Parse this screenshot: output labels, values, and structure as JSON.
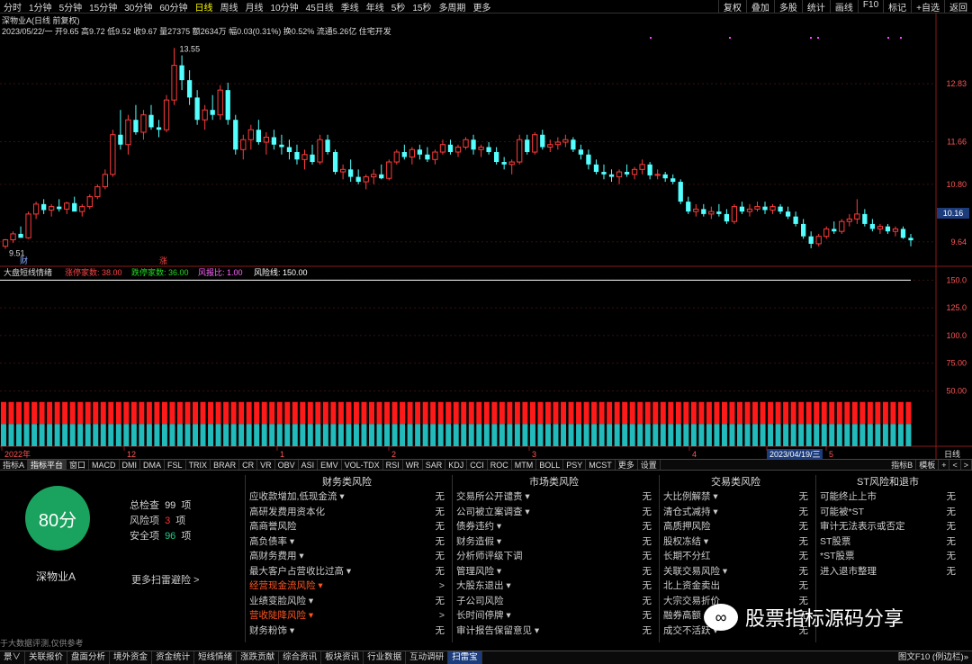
{
  "topbar": {
    "tabs": [
      "分时",
      "1分钟",
      "5分钟",
      "15分钟",
      "30分钟",
      "60分钟",
      "日线",
      "周线",
      "月线",
      "10分钟",
      "45日线",
      "季线",
      "年线",
      "5秒",
      "15秒",
      "多周期",
      "更多"
    ],
    "active_tab": "日线",
    "right_buttons": [
      "复权",
      "叠加",
      "多股",
      "统计",
      "画线",
      "F10",
      "标记",
      "+自选",
      "返回"
    ]
  },
  "info": {
    "title": "深物业A(日线 前复权)",
    "line": "2023/05/22/一  开9.65 高9.72 低9.52 收9.67 量27375 额2634万 幅0.03(0.31%) 换0.52% 流通5.26亿 住宅开发",
    "max_label": "13.55",
    "min_label": "9.51",
    "cai_label": "财",
    "zhang_label": "涨"
  },
  "colors": {
    "up": "#ff3b3b",
    "down": "#54ffff",
    "bar_red": "#ff1a1a",
    "bar_cyan": "#22bbbb",
    "axis_text": "#ff5555",
    "score_bg": "#1aa35e"
  },
  "price_axis": {
    "labels": [
      "12.83",
      "11.66",
      "10.80",
      "9.64"
    ],
    "values": [
      12.83,
      11.66,
      10.8,
      9.64
    ],
    "current_label": "10.16",
    "ylim": [
      9.2,
      14.1
    ]
  },
  "indicator": {
    "name": "大盘短线情绪",
    "items": [
      {
        "label": "涨停家数: 38.00",
        "color": "#ff4444"
      },
      {
        "label": "跌停家数: 36.00",
        "color": "#22dd22"
      },
      {
        "label": "风报比: 1.00",
        "color": "#ff66ff"
      },
      {
        "label": "风险线: 150.00",
        "color": "#ffffff"
      }
    ],
    "axis_labels": [
      "150.0",
      "125.0",
      "100.0",
      "75.00",
      "50.00"
    ],
    "axis_values": [
      150,
      125,
      100,
      75,
      50
    ],
    "ylim": [
      0,
      160
    ]
  },
  "date_axis": {
    "labels": [
      "2022年",
      "12",
      "1",
      "2",
      "3",
      "4",
      "2023/04/19/三",
      "5"
    ],
    "right": "日线"
  },
  "chart_data": {
    "type": "candlestick",
    "title": "深物业A(日线 前复权)",
    "candles": [
      [
        9.55,
        9.7,
        9.5,
        9.68
      ],
      [
        9.68,
        9.85,
        9.62,
        9.8
      ],
      [
        9.8,
        9.95,
        9.75,
        9.72
      ],
      [
        9.72,
        10.25,
        9.7,
        10.2
      ],
      [
        10.2,
        10.45,
        10.1,
        10.4
      ],
      [
        10.4,
        10.5,
        10.2,
        10.28
      ],
      [
        10.28,
        10.4,
        10.15,
        10.35
      ],
      [
        10.35,
        10.5,
        10.25,
        10.3
      ],
      [
        10.3,
        10.45,
        10.2,
        10.42
      ],
      [
        10.42,
        10.55,
        10.3,
        10.25
      ],
      [
        10.25,
        10.4,
        10.15,
        10.35
      ],
      [
        10.35,
        10.6,
        10.3,
        10.55
      ],
      [
        10.55,
        10.8,
        10.5,
        10.75
      ],
      [
        10.75,
        11.1,
        10.7,
        11.0
      ],
      [
        11.0,
        11.9,
        10.95,
        11.8
      ],
      [
        11.8,
        12.3,
        11.5,
        11.6
      ],
      [
        11.6,
        12.2,
        11.4,
        12.1
      ],
      [
        12.1,
        12.4,
        11.8,
        11.85
      ],
      [
        11.85,
        12.3,
        11.7,
        12.2
      ],
      [
        12.2,
        12.4,
        11.9,
        11.95
      ],
      [
        11.95,
        12.1,
        11.75,
        11.9
      ],
      [
        11.9,
        12.6,
        11.85,
        12.5
      ],
      [
        12.5,
        13.55,
        12.4,
        13.2
      ],
      [
        13.2,
        13.4,
        12.7,
        12.9
      ],
      [
        12.9,
        13.1,
        12.4,
        12.55
      ],
      [
        12.55,
        12.7,
        12.0,
        12.1
      ],
      [
        12.1,
        12.4,
        11.9,
        12.3
      ],
      [
        12.3,
        12.6,
        12.1,
        12.2
      ],
      [
        12.2,
        12.8,
        12.1,
        12.7
      ],
      [
        12.7,
        12.85,
        12.0,
        12.1
      ],
      [
        12.1,
        12.2,
        11.4,
        11.5
      ],
      [
        11.5,
        11.8,
        11.3,
        11.7
      ],
      [
        11.7,
        12.0,
        11.5,
        11.9
      ],
      [
        11.9,
        12.1,
        11.6,
        11.65
      ],
      [
        11.65,
        11.85,
        11.4,
        11.75
      ],
      [
        11.75,
        11.9,
        11.5,
        11.6
      ],
      [
        11.6,
        11.8,
        11.4,
        11.55
      ],
      [
        11.55,
        11.7,
        11.3,
        11.45
      ],
      [
        11.45,
        11.6,
        11.2,
        11.3
      ],
      [
        11.3,
        11.5,
        11.1,
        11.4
      ],
      [
        11.4,
        11.6,
        11.2,
        11.25
      ],
      [
        11.25,
        11.8,
        11.2,
        11.7
      ],
      [
        11.7,
        11.8,
        11.4,
        11.45
      ],
      [
        11.45,
        11.5,
        11.0,
        11.05
      ],
      [
        11.05,
        11.2,
        10.9,
        11.1
      ],
      [
        11.1,
        11.3,
        10.85,
        10.95
      ],
      [
        10.95,
        11.1,
        10.8,
        10.85
      ],
      [
        10.85,
        11.0,
        10.7,
        10.95
      ],
      [
        10.95,
        11.1,
        10.8,
        11.0
      ],
      [
        11.0,
        11.2,
        10.9,
        10.92
      ],
      [
        10.92,
        11.3,
        10.88,
        11.25
      ],
      [
        11.25,
        11.5,
        11.2,
        11.45
      ],
      [
        11.45,
        11.6,
        11.3,
        11.35
      ],
      [
        11.35,
        11.55,
        11.2,
        11.5
      ],
      [
        11.5,
        11.6,
        11.3,
        11.4
      ],
      [
        11.4,
        11.55,
        11.25,
        11.3
      ],
      [
        11.3,
        11.5,
        11.2,
        11.45
      ],
      [
        11.45,
        11.7,
        11.4,
        11.6
      ],
      [
        11.6,
        11.7,
        11.4,
        11.45
      ],
      [
        11.45,
        11.6,
        11.35,
        11.55
      ],
      [
        11.55,
        11.75,
        11.5,
        11.7
      ],
      [
        11.7,
        11.8,
        11.4,
        11.5
      ],
      [
        11.5,
        11.6,
        11.35,
        11.55
      ],
      [
        11.55,
        11.65,
        11.4,
        11.45
      ],
      [
        11.45,
        11.55,
        11.2,
        11.25
      ],
      [
        11.25,
        11.35,
        11.1,
        11.2
      ],
      [
        11.2,
        11.3,
        11.0,
        11.25
      ],
      [
        11.25,
        11.8,
        11.2,
        11.7
      ],
      [
        11.7,
        11.8,
        11.4,
        11.45
      ],
      [
        11.45,
        11.85,
        11.4,
        11.8
      ],
      [
        11.8,
        11.9,
        11.5,
        11.55
      ],
      [
        11.55,
        11.7,
        11.45,
        11.6
      ],
      [
        11.6,
        11.75,
        11.5,
        11.65
      ],
      [
        11.65,
        11.8,
        11.55,
        11.7
      ],
      [
        11.7,
        11.75,
        11.45,
        11.5
      ],
      [
        11.5,
        11.6,
        11.3,
        11.4
      ],
      [
        11.4,
        11.5,
        11.1,
        11.2
      ],
      [
        11.2,
        11.3,
        11.0,
        11.05
      ],
      [
        11.05,
        11.2,
        10.9,
        11.0
      ],
      [
        11.0,
        11.1,
        10.85,
        10.95
      ],
      [
        10.95,
        11.1,
        10.8,
        11.05
      ],
      [
        11.05,
        11.2,
        10.95,
        11.0
      ],
      [
        11.0,
        11.15,
        10.9,
        11.1
      ],
      [
        11.1,
        11.3,
        11.0,
        11.2
      ],
      [
        11.2,
        11.25,
        10.9,
        10.98
      ],
      [
        10.98,
        11.1,
        10.9,
        11.0
      ],
      [
        11.0,
        11.05,
        10.85,
        10.92
      ],
      [
        10.92,
        11.0,
        10.8,
        10.85
      ],
      [
        10.85,
        10.9,
        10.4,
        10.45
      ],
      [
        10.45,
        10.55,
        10.2,
        10.25
      ],
      [
        10.25,
        10.4,
        10.15,
        10.3
      ],
      [
        10.3,
        10.4,
        10.15,
        10.2
      ],
      [
        10.2,
        10.35,
        10.1,
        10.25
      ],
      [
        10.25,
        10.4,
        10.15,
        10.2
      ],
      [
        10.2,
        10.3,
        10.0,
        10.05
      ],
      [
        10.05,
        10.4,
        10.0,
        10.35
      ],
      [
        10.35,
        10.45,
        10.2,
        10.25
      ],
      [
        10.25,
        10.4,
        10.15,
        10.3
      ],
      [
        10.3,
        10.45,
        10.25,
        10.35
      ],
      [
        10.35,
        10.45,
        10.2,
        10.28
      ],
      [
        10.28,
        10.4,
        10.2,
        10.35
      ],
      [
        10.35,
        10.4,
        10.2,
        10.25
      ],
      [
        10.25,
        10.35,
        10.1,
        10.15
      ],
      [
        10.15,
        10.25,
        9.95,
        10.0
      ],
      [
        10.0,
        10.1,
        9.7,
        9.75
      ],
      [
        9.75,
        9.85,
        9.51,
        9.6
      ],
      [
        9.6,
        9.8,
        9.55,
        9.75
      ],
      [
        9.75,
        9.95,
        9.7,
        9.9
      ],
      [
        9.9,
        10.05,
        9.8,
        9.85
      ],
      [
        9.85,
        10.1,
        9.8,
        10.05
      ],
      [
        10.05,
        10.2,
        9.95,
        10.1
      ],
      [
        10.1,
        10.5,
        10.0,
        10.2
      ],
      [
        10.2,
        10.3,
        9.95,
        10.0
      ],
      [
        10.0,
        10.1,
        9.85,
        9.9
      ],
      [
        9.9,
        10.0,
        9.8,
        9.95
      ],
      [
        9.95,
        10.0,
        9.8,
        9.85
      ],
      [
        9.85,
        9.95,
        9.75,
        9.9
      ],
      [
        9.9,
        9.95,
        9.7,
        9.72
      ],
      [
        9.72,
        9.8,
        9.55,
        9.67
      ]
    ],
    "indicator_bars": {
      "red_top": 40,
      "cyan_top": 20
    }
  },
  "ind_tabs": {
    "items": [
      "指标A",
      "指标平台",
      "窗口",
      "MACD",
      "DMI",
      "DMA",
      "FSL",
      "TRIX",
      "BRAR",
      "CR",
      "VR",
      "OBV",
      "ASI",
      "EMV",
      "VOL-TDX",
      "RSI",
      "WR",
      "SAR",
      "KDJ",
      "CCI",
      "ROC",
      "MTM",
      "BOLL",
      "PSY",
      "MCST",
      "更多",
      "设置"
    ],
    "active": "指标平台",
    "right": [
      "指标B",
      "模板",
      "+",
      "<",
      ">"
    ]
  },
  "panel": {
    "score": "80分",
    "stock_name": "深物业A",
    "stat_total_label": "总检查",
    "stat_total": "99",
    "stat_total_unit": "项",
    "stat_risk_label": "风险项",
    "stat_risk": "3",
    "stat_risk_unit": "项",
    "stat_safe_label": "安全项",
    "stat_safe": "96",
    "stat_safe_unit": "项",
    "more_link": "更多扫雷避险 >",
    "disclaimer": "于大数据评测,仅供参考",
    "columns": [
      {
        "title": "财务类风险",
        "rows": [
          {
            "label": "应收款增加,低现金流 ▾",
            "value": "无",
            "warn": false
          },
          {
            "label": "高研发费用资本化",
            "value": "无",
            "warn": false
          },
          {
            "label": "高商誉风险",
            "value": "无",
            "warn": false
          },
          {
            "label": "高负债率 ▾",
            "value": "无",
            "warn": false
          },
          {
            "label": "高财务费用 ▾",
            "value": "无",
            "warn": false
          },
          {
            "label": "最大客户占营收比过高 ▾",
            "value": "无",
            "warn": false
          },
          {
            "label": "经营现金流风险 ▾",
            "value": ">",
            "warn": true
          },
          {
            "label": "业绩变脸风险 ▾",
            "value": "无",
            "warn": false
          },
          {
            "label": "营收陡降风险 ▾",
            "value": ">",
            "warn": true
          },
          {
            "label": "财务粉饰 ▾",
            "value": "无",
            "warn": false
          }
        ]
      },
      {
        "title": "市场类风险",
        "rows": [
          {
            "label": "交易所公开谴责 ▾",
            "value": "无",
            "warn": false
          },
          {
            "label": "公司被立案调查 ▾",
            "value": "无",
            "warn": false
          },
          {
            "label": "债券违约 ▾",
            "value": "无",
            "warn": false
          },
          {
            "label": "财务造假 ▾",
            "value": "无",
            "warn": false
          },
          {
            "label": "分析师评级下调",
            "value": "无",
            "warn": false
          },
          {
            "label": "管理风险 ▾",
            "value": "无",
            "warn": false
          },
          {
            "label": "大股东退出 ▾",
            "value": "无",
            "warn": false
          },
          {
            "label": "子公司风险",
            "value": "无",
            "warn": false
          },
          {
            "label": "长时间停牌 ▾",
            "value": "无",
            "warn": false
          },
          {
            "label": "审计报告保留意见 ▾",
            "value": "无",
            "warn": false
          }
        ]
      },
      {
        "title": "交易类风险",
        "rows": [
          {
            "label": "大比例解禁 ▾",
            "value": "无",
            "warn": false
          },
          {
            "label": "清仓式减持 ▾",
            "value": "无",
            "warn": false
          },
          {
            "label": "高质押风险",
            "value": "无",
            "warn": false
          },
          {
            "label": "股权冻结 ▾",
            "value": "无",
            "warn": false
          },
          {
            "label": "长期不分红",
            "value": "无",
            "warn": false
          },
          {
            "label": "关联交易风险 ▾",
            "value": "无",
            "warn": false
          },
          {
            "label": "北上资金卖出",
            "value": "无",
            "warn": false
          },
          {
            "label": "大宗交易折价",
            "value": "无",
            "warn": false
          },
          {
            "label": "融券高额",
            "value": "无",
            "warn": false
          },
          {
            "label": "成交不活跃 ▾",
            "value": "无",
            "warn": false
          }
        ]
      },
      {
        "title": "ST风险和退市",
        "rows": [
          {
            "label": "可能终止上市",
            "value": "无",
            "warn": false
          },
          {
            "label": "可能被*ST",
            "value": "无",
            "warn": false
          },
          {
            "label": "审计无法表示或否定",
            "value": "无",
            "warn": false
          },
          {
            "label": "ST股票",
            "value": "无",
            "warn": false
          },
          {
            "label": "*ST股票",
            "value": "无",
            "warn": false
          },
          {
            "label": "进入退市整理",
            "value": "无",
            "warn": false
          }
        ]
      }
    ]
  },
  "statusbar": {
    "items": [
      "景∨",
      "关联报价",
      "盘面分析",
      "境外资金",
      "资金统计",
      "短线情绪",
      "涨跌贡献",
      "综合资讯",
      "板块资讯",
      "行业数据",
      "互动调研",
      "扫雷宝"
    ],
    "active": "扫雷宝",
    "right": "图文F10 (例边栏)»"
  },
  "watermark": {
    "icon": "∞",
    "text": "股票指标源码分享"
  }
}
